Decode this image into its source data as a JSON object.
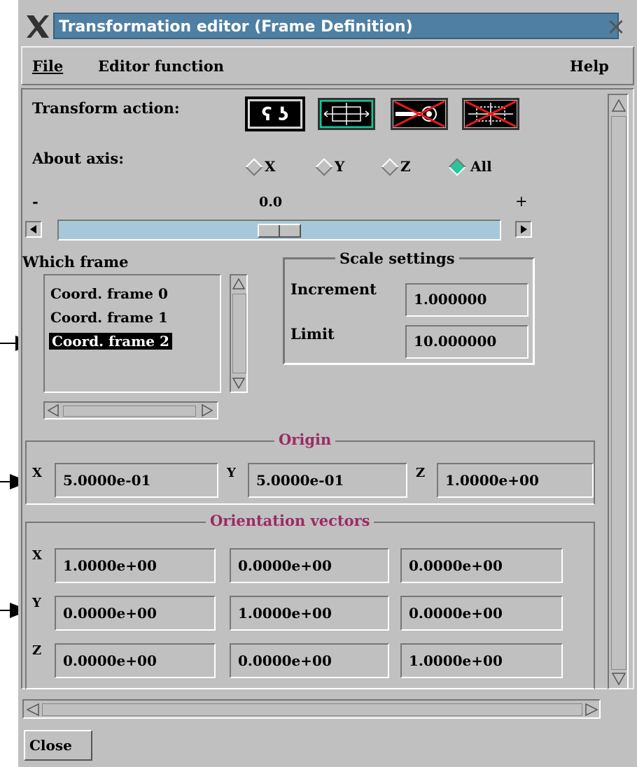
{
  "window": {
    "title": "Transformation editor (Frame Definition)"
  },
  "menu": {
    "file": "File",
    "editor_function": "Editor function",
    "help": "Help"
  },
  "transform": {
    "label": "Transform action:",
    "actions": [
      "rotate-icon",
      "translate-icon",
      "scale-icon",
      "scale-all-icon"
    ]
  },
  "axis": {
    "label": "About axis:",
    "options": [
      "X",
      "Y",
      "Z",
      "All"
    ],
    "selected": "All"
  },
  "slider": {
    "minus": "-",
    "value": "0.0",
    "plus": "+"
  },
  "which_frame": {
    "label": "Which frame",
    "items": [
      "Coord. frame 0",
      "Coord. frame 1",
      "Coord. frame 2"
    ],
    "selected": "Coord. frame 2"
  },
  "scale_settings": {
    "title": "Scale settings",
    "increment_label": "Increment",
    "increment_value": "1.000000",
    "limit_label": "Limit",
    "limit_value": "10.000000"
  },
  "origin": {
    "title": "Origin",
    "x_label": "X",
    "x": "5.0000e-01",
    "y_label": "Y",
    "y": "5.0000e-01",
    "z_label": "Z",
    "z": "1.0000e+00"
  },
  "orientation": {
    "title": "Orientation vectors",
    "rows": [
      {
        "label": "X",
        "values": [
          "1.0000e+00",
          "0.0000e+00",
          "0.0000e+00"
        ]
      },
      {
        "label": "Y",
        "values": [
          "0.0000e+00",
          "1.0000e+00",
          "0.0000e+00"
        ]
      },
      {
        "label": "Z",
        "values": [
          "0.0000e+00",
          "0.0000e+00",
          "1.0000e+00"
        ]
      }
    ]
  },
  "close_label": "Close",
  "colors": {
    "title_bar": "#4f7fa3",
    "group_title": "#9b2b63",
    "slider_trough": "#a7c8d8",
    "selected_diamond": "#2ec49a",
    "button_highlight": "#11c89a"
  }
}
